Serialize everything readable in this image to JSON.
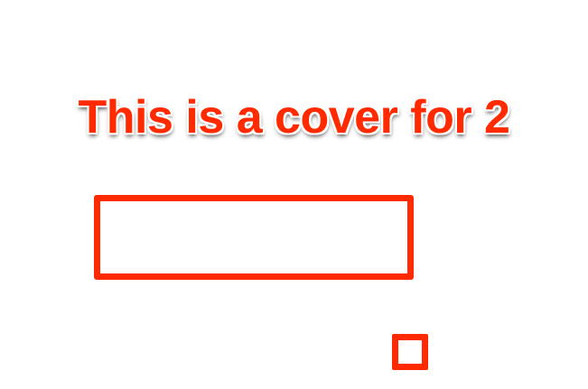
{
  "cover": {
    "title": "This is a cover for 2"
  },
  "colors": {
    "accent": "#ff2a00",
    "background": "#ffffff"
  }
}
